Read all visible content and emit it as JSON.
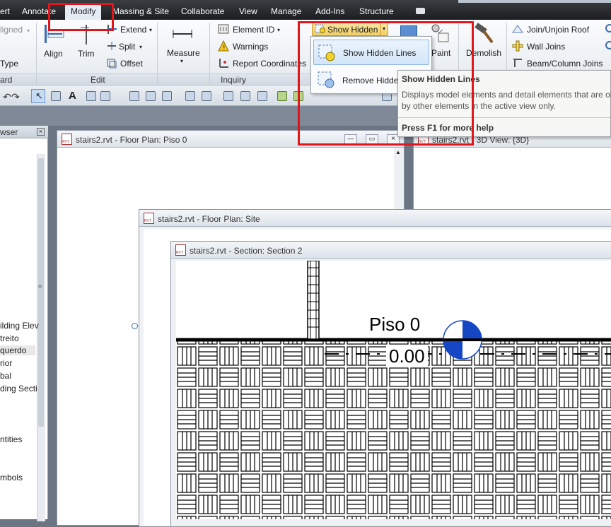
{
  "menubar": {
    "tabs": [
      "ert",
      "Annotate",
      "Modify",
      "Massing & Site",
      "Collaborate",
      "View",
      "Manage",
      "Add-Ins",
      "Structure"
    ]
  },
  "ribbon": {
    "left_cut": {
      "aligned": "ligned",
      "type": "Type",
      "panel": "ard"
    },
    "edit": {
      "align": "Align",
      "trim": "Trim",
      "extend": "Extend",
      "split": "Split",
      "offset": "Offset",
      "panel": "Edit"
    },
    "measure": {
      "label": "Measure"
    },
    "inquiry": {
      "element_id": "Element ID",
      "warnings": "Warnings",
      "report": "Report Coordinates",
      "panel": "Inquiry"
    },
    "show_hidden": {
      "label": "Show Hidden"
    },
    "paint": "Paint",
    "demolish": "Demolish",
    "joins": {
      "join_roof": "Join/Unjoin Roof",
      "wall_joins": "Wall Joins",
      "beam_joins": "Beam/Column Joins"
    }
  },
  "dropdown": {
    "show_hidden_lines": "Show Hidden Lines",
    "remove_hidden": "Remove Hidde"
  },
  "tooltip": {
    "title": "Show Hidden Lines",
    "body_line1": "Displays model elements and detail elements that are ol",
    "body_line2": "by other elements in the active view only.",
    "footer": "Press F1 for more help"
  },
  "browser": {
    "title": "wser",
    "items": [
      "ilding Elev",
      "treito",
      "querdo",
      "rior",
      "bal",
      "ding Secti",
      "ntities",
      "mbols"
    ]
  },
  "windows": {
    "plan_piso0": "stairs2.rvt - Floor Plan: Piso 0",
    "view_3d": "stairs2.rvt - 3D View: {3D}",
    "plan_site": "stairs2.rvt - Floor Plan: Site",
    "section2": "stairs2.rvt - Section: Section 2"
  },
  "section": {
    "level_name": "Piso 0",
    "elevation": "0.00"
  },
  "colors": {
    "highlight_red": "#e0161b",
    "level_blue": "#1547c4"
  }
}
